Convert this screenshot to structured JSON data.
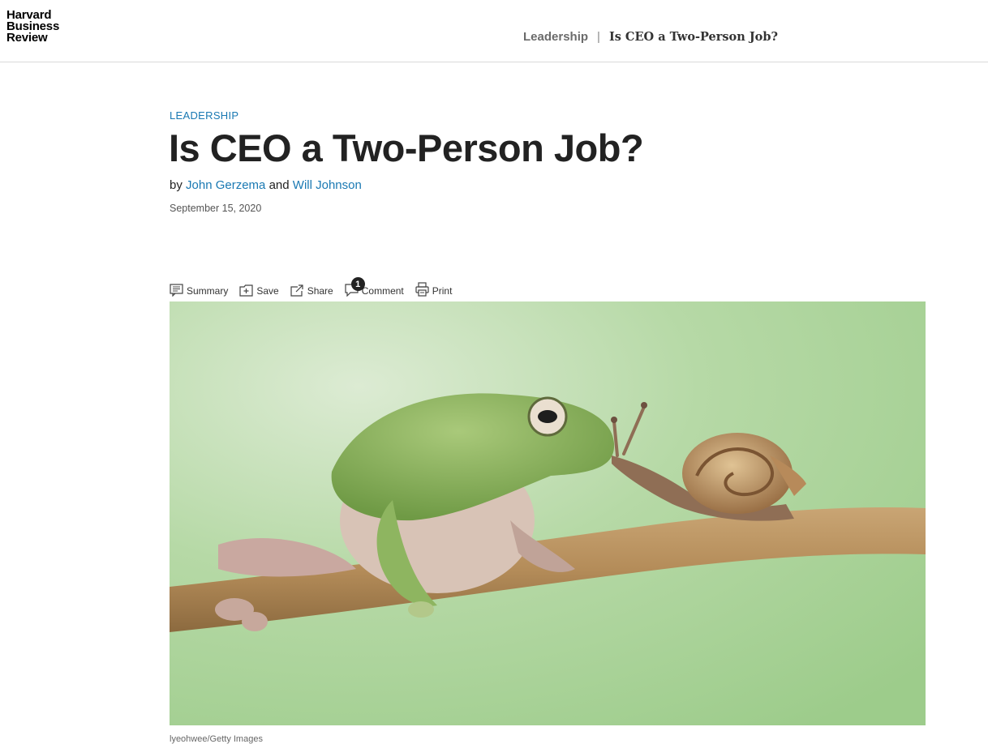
{
  "header": {
    "logo_lines": [
      "Harvard",
      "Business",
      "Review"
    ],
    "breadcrumb_section": "Leadership",
    "breadcrumb_separator": "|",
    "breadcrumb_title": "Is CEO a Two-Person Job?"
  },
  "article": {
    "topic": "LEADERSHIP",
    "title": "Is CEO a Two-Person Job?",
    "byline_prefix": "by",
    "authors": [
      "John Gerzema",
      "Will Johnson"
    ],
    "byline_joiner": "and",
    "date": "September 15, 2020",
    "image_credit": "lyeohwee/Getty Images"
  },
  "toolbar": {
    "items": [
      {
        "label": "Summary",
        "icon": "summary-icon"
      },
      {
        "label": "Save",
        "icon": "save-icon"
      },
      {
        "label": "Share",
        "icon": "share-icon"
      },
      {
        "label": "Comment",
        "icon": "comment-icon",
        "badge": "1"
      },
      {
        "label": "Print",
        "icon": "print-icon"
      }
    ]
  },
  "colors": {
    "accent_link": "#1a79b3",
    "text": "#222222",
    "hero_background": "#a9d39a"
  }
}
